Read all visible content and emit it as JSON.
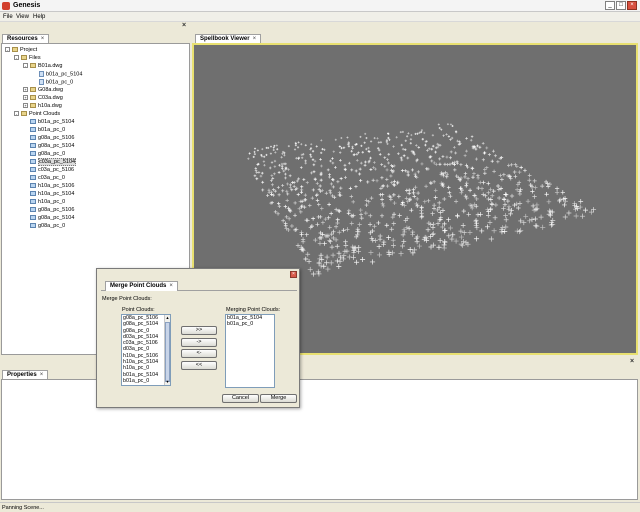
{
  "app": {
    "title": "Genesis"
  },
  "menu": [
    "File",
    "View",
    "Help"
  ],
  "resources": {
    "tab_label": "Resources",
    "tree": [
      {
        "label": "Project",
        "level": 0,
        "toggle": "-",
        "icon": "project-icon"
      },
      {
        "label": "Files",
        "level": 1,
        "toggle": "-",
        "icon": "folder-icon"
      },
      {
        "label": "B01a.dwg",
        "level": 2,
        "toggle": "-",
        "icon": "dwg-file-icon"
      },
      {
        "label": "b01a_pc_5104",
        "level": 3,
        "toggle": "",
        "icon": "document-icon"
      },
      {
        "label": "b01a_pc_0",
        "level": 3,
        "toggle": "",
        "icon": "document-icon"
      },
      {
        "label": "G08a.dwg",
        "level": 2,
        "toggle": "+",
        "icon": "dwg-file-icon"
      },
      {
        "label": "C03a.dwg",
        "level": 2,
        "toggle": "+",
        "icon": "dwg-file-icon"
      },
      {
        "label": "h10a.dwg",
        "level": 2,
        "toggle": "+",
        "icon": "dwg-file-icon"
      },
      {
        "label": "Point Clouds",
        "level": 1,
        "toggle": "-",
        "icon": "folder-icon"
      },
      {
        "label": "b01a_pc_5104",
        "level": 2,
        "toggle": "",
        "icon": "point-cloud-icon"
      },
      {
        "label": "b01a_pc_0",
        "level": 2,
        "toggle": "",
        "icon": "point-cloud-icon"
      },
      {
        "label": "g08a_pc_5106",
        "level": 2,
        "toggle": "",
        "icon": "point-cloud-icon"
      },
      {
        "label": "g08a_pc_5104",
        "level": 2,
        "toggle": "",
        "icon": "point-cloud-icon"
      },
      {
        "label": "g08a_pc_0",
        "level": 2,
        "toggle": "",
        "icon": "point-cloud-icon"
      },
      {
        "label": "c03a_pc_5104",
        "level": 2,
        "toggle": "",
        "icon": "point-cloud-icon",
        "selected": true
      },
      {
        "label": "c03a_pc_5106",
        "level": 2,
        "toggle": "",
        "icon": "point-cloud-icon"
      },
      {
        "label": "c03a_pc_0",
        "level": 2,
        "toggle": "",
        "icon": "point-cloud-icon"
      },
      {
        "label": "h10a_pc_5106",
        "level": 2,
        "toggle": "",
        "icon": "point-cloud-icon"
      },
      {
        "label": "h10a_pc_5104",
        "level": 2,
        "toggle": "",
        "icon": "point-cloud-icon"
      },
      {
        "label": "h10a_pc_0",
        "level": 2,
        "toggle": "",
        "icon": "point-cloud-icon"
      },
      {
        "label": "g08a_pc_5106",
        "level": 2,
        "toggle": "",
        "icon": "point-cloud-icon"
      },
      {
        "label": "g08a_pc_5104",
        "level": 2,
        "toggle": "",
        "icon": "point-cloud-icon"
      },
      {
        "label": "g08a_pc_0",
        "level": 2,
        "toggle": "",
        "icon": "point-cloud-icon"
      }
    ]
  },
  "viewer": {
    "tab_label": "Spellbook Viewer",
    "background": "#6f6f6f",
    "point_color": "#ffffff",
    "frame_color": "#e8e070"
  },
  "properties": {
    "tab_label": "Properties"
  },
  "dialog": {
    "title": "Merge Point Clouds",
    "heading": "Merge Point Clouds:",
    "left_label": "Point Clouds:",
    "right_label": "Merging Point Clouds:",
    "left_items": [
      "g08a_pc_5106",
      "g08a_pc_5104",
      "g08a_pc_0",
      "d03a_pc_5104",
      "c03a_pc_5106",
      "d03a_pc_0",
      "h10a_pc_5106",
      "h10a_pc_5104",
      "h10a_pc_0",
      "b01a_pc_5104",
      "b01a_pc_0"
    ],
    "right_items": [
      "b01a_pc_5104",
      "b01a_pc_0"
    ],
    "buttons": {
      "add_all": ">>",
      "add": "->",
      "remove": "<-",
      "remove_all": "<<",
      "cancel": "Cancel",
      "merge": "Merge"
    }
  },
  "status": {
    "text": "Panning Scene..."
  }
}
